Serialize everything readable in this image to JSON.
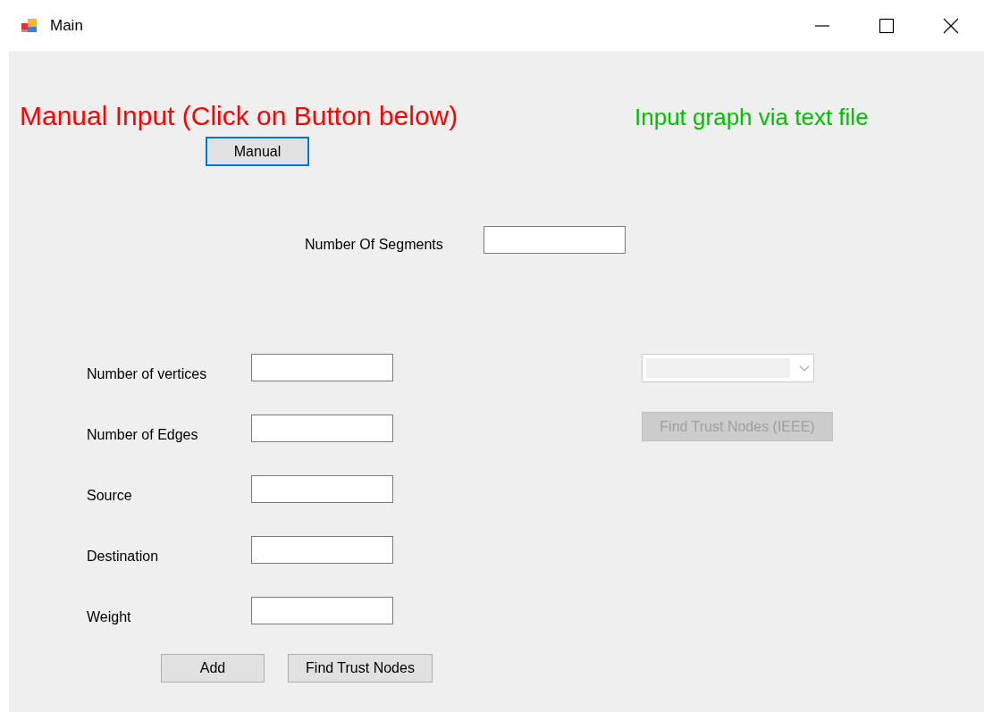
{
  "window": {
    "title": "Main"
  },
  "manual_heading": "Manual Input (Click on Button below)",
  "file_heading": "Input graph via text file",
  "manual_button": {
    "label": "Manual",
    "focused": true
  },
  "segments": {
    "label": "Number Of Segments"
  },
  "fields": [
    {
      "label": "Number of vertices"
    },
    {
      "label": "Number of Edges"
    },
    {
      "label": "Source"
    },
    {
      "label": "Destination"
    },
    {
      "label": "Weight"
    }
  ],
  "graph_dropdown": {
    "disabled": true
  },
  "ieee_button": {
    "label": "Find Trust Nodes (IEEE)",
    "disabled": true
  },
  "actions": [
    {
      "label": "Add"
    },
    {
      "label": "Find Trust Nodes"
    }
  ]
}
